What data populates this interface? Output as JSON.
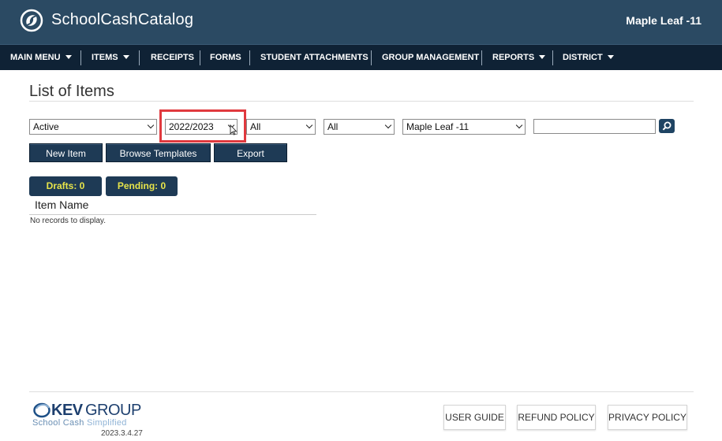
{
  "header": {
    "brand": "SchoolCashCatalog",
    "school": "Maple Leaf -11"
  },
  "nav": {
    "items": [
      {
        "label": "MAIN MENU",
        "caret": true
      },
      {
        "label": "ITEMS",
        "caret": true
      },
      {
        "label": "RECEIPTS",
        "caret": false
      },
      {
        "label": "FORMS",
        "caret": false
      },
      {
        "label": "STUDENT ATTACHMENTS",
        "caret": false
      },
      {
        "label": "GROUP MANAGEMENT",
        "caret": false
      },
      {
        "label": "REPORTS",
        "caret": true
      },
      {
        "label": "DISTRICT",
        "caret": true
      }
    ]
  },
  "main": {
    "title": "List of Items",
    "filters": {
      "status": "Active",
      "year": "2022/2023",
      "filter3": "All",
      "filter4": "All",
      "school": "Maple Leaf -11",
      "search_value": ""
    },
    "buttons": {
      "new_item": "New Item",
      "browse_templates": "Browse Templates",
      "export": "Export"
    },
    "badges": {
      "drafts": "Drafts: 0",
      "pending": "Pending: 0"
    },
    "table": {
      "column": "Item Name",
      "empty": "No records to display."
    }
  },
  "footer": {
    "logo_text_kev": "KEV",
    "logo_text_group": "GROUP",
    "tagline_a": "School Cash ",
    "tagline_b": "Simplified",
    "version": "2023.3.4.27",
    "links": {
      "user_guide": "USER GUIDE",
      "refund_policy": "REFUND POLICY",
      "privacy_policy": "PRIVACY POLICY"
    }
  },
  "colors": {
    "header_bg": "#2b4a63",
    "nav_bg": "#0f2235",
    "button_bg": "#1e3a55",
    "badge_text": "#e7e44a",
    "highlight": "#e0393e"
  }
}
